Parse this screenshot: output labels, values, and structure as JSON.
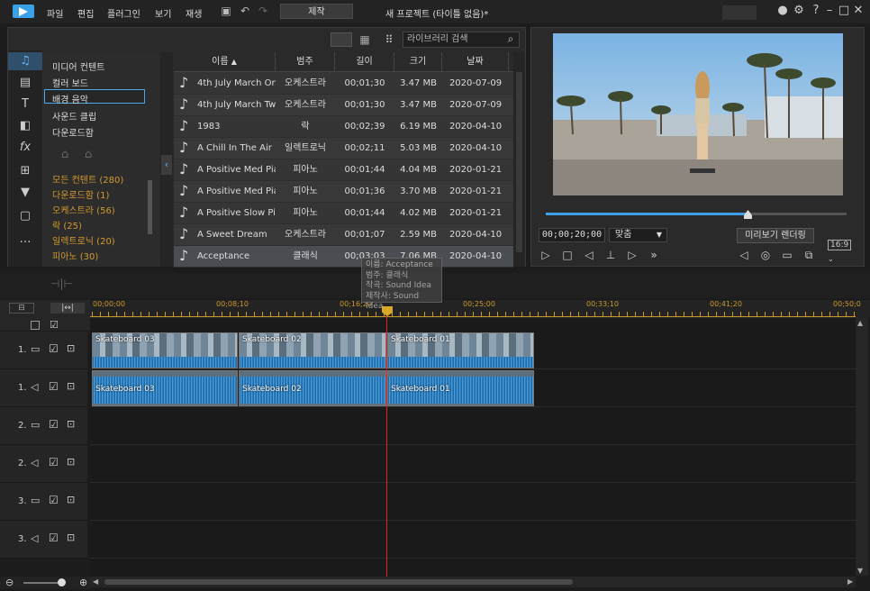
{
  "menubar": {
    "items": [
      "파일",
      "편집",
      "플러그인",
      "보기",
      "재생"
    ],
    "produce_label": "제작",
    "project_title": "새 프로젝트 (타이틀 없음)*"
  },
  "library": {
    "categories": [
      "미디어 컨텐트",
      "컬러 보드",
      "배경 음악",
      "사운드 클립",
      "다운로드함"
    ],
    "selected_category": "배경 음악",
    "tags": [
      "모든 컨텐트 (280)",
      "다운로드함 (1)",
      "오케스트라 (56)",
      "락 (25)",
      "일렉트로닉 (20)",
      "피아노 (30)"
    ],
    "search_placeholder": "라이브러리 검색",
    "columns": [
      "이름",
      "범주",
      "길이",
      "크기",
      "날짜"
    ],
    "rows": [
      {
        "name": "4th July March One",
        "genre": "오케스트라",
        "length": "00;01;30",
        "size": "3.47 MB",
        "date": "2020-07-09"
      },
      {
        "name": "4th July March Two",
        "genre": "오케스트라",
        "length": "00;01;30",
        "size": "3.47 MB",
        "date": "2020-07-09"
      },
      {
        "name": "1983",
        "genre": "락",
        "length": "00;02;39",
        "size": "6.19 MB",
        "date": "2020-04-10"
      },
      {
        "name": "A Chill In The Air",
        "genre": "일렉트로닉",
        "length": "00;02;11",
        "size": "5.03 MB",
        "date": "2020-04-10"
      },
      {
        "name": "A Positive Med Pia...",
        "genre": "피아노",
        "length": "00;01;44",
        "size": "4.04 MB",
        "date": "2020-01-21"
      },
      {
        "name": "A Positive Med Pia...",
        "genre": "피아노",
        "length": "00;01;36",
        "size": "3.70 MB",
        "date": "2020-01-21"
      },
      {
        "name": "A Positive Slow Pia...",
        "genre": "피아노",
        "length": "00;01;44",
        "size": "4.02 MB",
        "date": "2020-01-21"
      },
      {
        "name": "A Sweet Dream",
        "genre": "오케스트라",
        "length": "00;01;07",
        "size": "2.59 MB",
        "date": "2020-04-10"
      },
      {
        "name": "Acceptance",
        "genre": "클래식",
        "length": "00;03;03",
        "size": "7.06 MB",
        "date": "2020-04-10"
      }
    ],
    "tooltip": [
      "이름: Acceptance",
      "범주: 클래식",
      "작곡: Sound Idea",
      "제작사: Sound Idea"
    ]
  },
  "preview": {
    "timecode": "00;00;20;00",
    "fit_label": "맞춤",
    "render_label": "미리보기 렌더링",
    "aspect_label": "16:9",
    "progress": 0.67
  },
  "timeline": {
    "ruler_labels": [
      "00;00;00",
      "00;08;10",
      "00;16;20",
      "00;25;00",
      "00;33;10",
      "00;41;20",
      "00;50;0"
    ],
    "tracks": [
      {
        "label": "1.",
        "type": "video"
      },
      {
        "label": "1.",
        "type": "audio"
      },
      {
        "label": "2.",
        "type": "video"
      },
      {
        "label": "2.",
        "type": "audio"
      },
      {
        "label": "3.",
        "type": "video"
      },
      {
        "label": "3.",
        "type": "audio"
      }
    ],
    "video_clips": [
      "Skateboard 03",
      "Skateboard 02",
      "Skateboard 01"
    ],
    "audio_clips": [
      "Skateboard 03",
      "Skateboard 02",
      "Skateboard 01"
    ]
  },
  "colors": {
    "accent": "#3ea0e6",
    "playhead": "#e02020",
    "ruler": "#c99a2a",
    "tags": "#d49a2e"
  }
}
